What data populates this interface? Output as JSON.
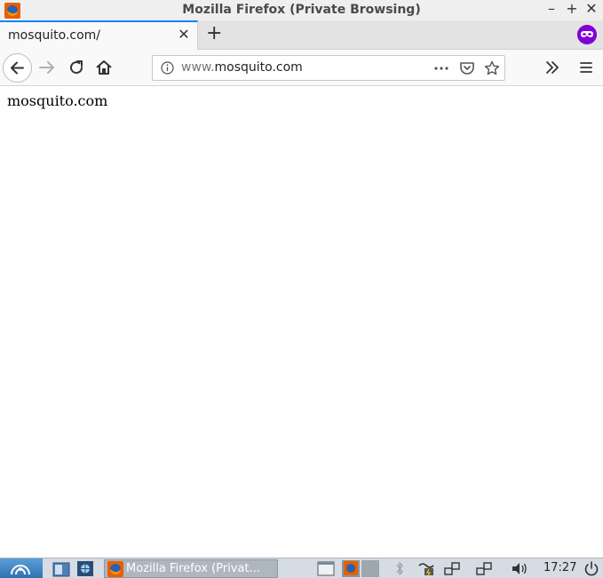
{
  "window": {
    "title": "Mozilla Firefox (Private Browsing)"
  },
  "tabs": [
    {
      "label": "mosquito.com/"
    }
  ],
  "urlbar": {
    "prefix": "www.",
    "domain": "mosquito.com"
  },
  "page": {
    "text": "mosquito.com"
  },
  "taskbar": {
    "task_label": "Mozilla Firefox (Privat...",
    "clock": "17:27"
  },
  "colors": {
    "private_purple": "#8000d7",
    "tab_accent": "#0a84ff",
    "taskbar_bg": "#d6dce3"
  }
}
